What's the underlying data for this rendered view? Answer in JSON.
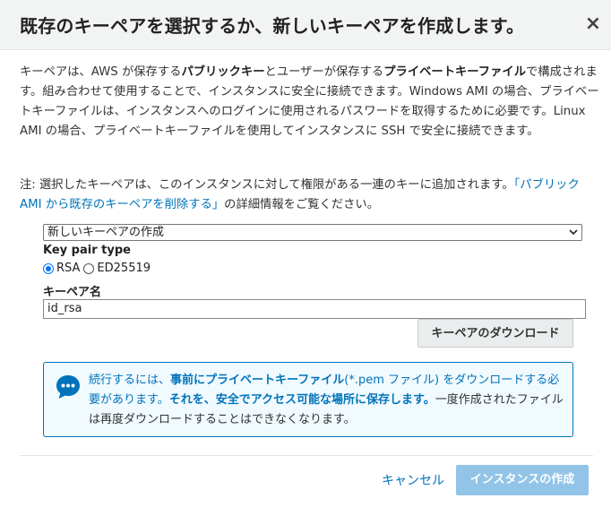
{
  "dialog": {
    "title": "既存のキーペアを選択するか、新しいキーペアを作成します。",
    "close_glyph": "×"
  },
  "description": {
    "p1": "キーペアは、AWS が保存する",
    "b1": "パブリックキー",
    "p2": "とユーザーが保存する",
    "b2": "プライベートキーファイル",
    "p3": "で構成されます。組み合わせて使用することで、インスタンスに安全に接続できます。Windows AMI の場合、プライベートキーファイルは、インスタンスへのログインに使用されるパスワードを取得するために必要です。Linux AMI の場合、プライベートキーファイルを使用してインスタンスに SSH で安全に接続できます。"
  },
  "note": {
    "prefix": "注: 選択したキーペアは、このインスタンスに対して権限がある一連のキーに追加されます。",
    "link": "「パブリック AMI から既存のキーペアを削除する」",
    "suffix": "の詳細情報をご覧ください。"
  },
  "form": {
    "select_value": "新しいキーペアの作成",
    "key_pair_type_label": "Key pair type",
    "radio_rsa": "RSA",
    "radio_ed25519": "ED25519",
    "selected_type": "RSA",
    "key_pair_name_label": "キーペア名",
    "key_pair_name_value": "id_rsa",
    "download_button": "キーペアのダウンロード"
  },
  "info": {
    "t1": "続行するには、",
    "b1": "事前にプライベートキーファイル",
    "t2": "(*.pem ファイル) をダウンロードする必要があります。",
    "b2": "それを、安全でアクセス可能な場所に保存します。",
    "t3": "一度作成されたファイルは再度ダウンロードすることはできなくなります。",
    "icon": "speech-bubble-icon"
  },
  "footer": {
    "cancel": "キャンセル",
    "create": "インスタンスの作成"
  },
  "colors": {
    "link": "#0073bb",
    "primary_disabled": "#92c4e8",
    "info_border": "#0073bb",
    "info_bg": "#f1faff"
  }
}
